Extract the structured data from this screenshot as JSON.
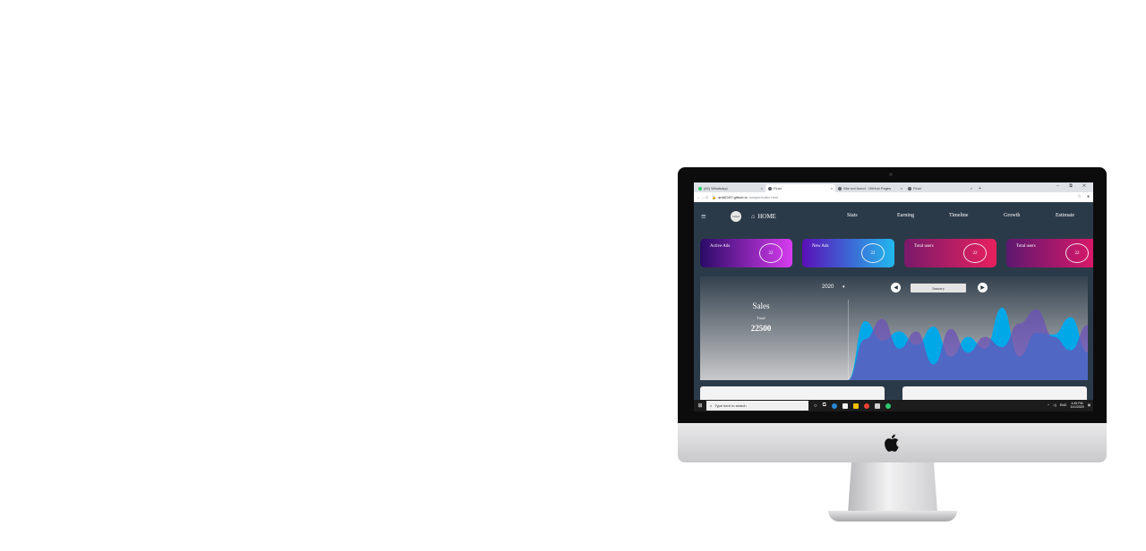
{
  "browser": {
    "tabs": [
      {
        "label": "(62) WhatsApp",
        "active": false,
        "favicon": "whatsapp-icon"
      },
      {
        "label": "Final",
        "active": true,
        "favicon": "globe-icon"
      },
      {
        "label": "Site not found · GitHub Pages",
        "active": false,
        "favicon": "globe-icon"
      },
      {
        "label": "Final",
        "active": false,
        "favicon": "globe-icon"
      }
    ],
    "new_tab": "+",
    "window_controls": "– ⧉ ✕",
    "nav_icons": "← → C",
    "url_host": "amit2197.github.io",
    "url_path": "/simple/index.html"
  },
  "dashboard": {
    "logo_text": "LOGO",
    "home_label": "HOME",
    "nav_links": [
      "Stats",
      "Earning",
      "Timeline",
      "Growth",
      "Estimate"
    ],
    "cards": [
      {
        "label": "Active Ads",
        "value": "22"
      },
      {
        "label": "New Ads",
        "value": "22"
      },
      {
        "label": "Total users",
        "value": "22"
      },
      {
        "label": "Total users",
        "value": "22"
      }
    ],
    "year": "2020",
    "month": "January",
    "sales_title": "Sales",
    "sales_sub": "Total",
    "sales_value": "22500"
  },
  "chart_data": {
    "type": "area",
    "series": [
      {
        "values": [
          0,
          0.75,
          0.5,
          0.62,
          0.45,
          0.68,
          0.3,
          0.55,
          0.4,
          0.92,
          0.3,
          0.6,
          0.58,
          0.8,
          0.35
        ]
      },
      {
        "values": [
          0,
          0.52,
          0.78,
          0.4,
          0.62,
          0.2,
          0.65,
          0.35,
          0.55,
          0.42,
          0.72,
          0.9,
          0.55,
          0.38,
          0.7
        ]
      }
    ],
    "colors": [
      "#00a8e8",
      "#6b52b8"
    ]
  },
  "taskbar": {
    "search_placeholder": "Type here to search",
    "time": "4:45 PM",
    "date": "11/1/2020",
    "lang": "ENG"
  }
}
